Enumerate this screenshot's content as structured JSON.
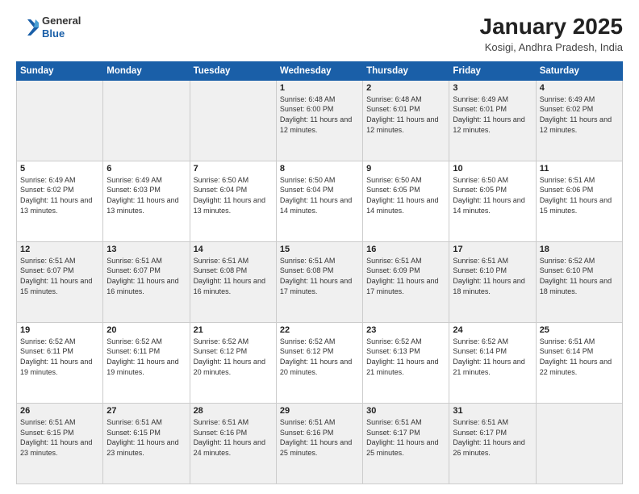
{
  "header": {
    "logo_general": "General",
    "logo_blue": "Blue",
    "month_title": "January 2025",
    "location": "Kosigi, Andhra Pradesh, India"
  },
  "days_of_week": [
    "Sunday",
    "Monday",
    "Tuesday",
    "Wednesday",
    "Thursday",
    "Friday",
    "Saturday"
  ],
  "weeks": [
    [
      {
        "day": "",
        "info": ""
      },
      {
        "day": "",
        "info": ""
      },
      {
        "day": "",
        "info": ""
      },
      {
        "day": "1",
        "info": "Sunrise: 6:48 AM\nSunset: 6:00 PM\nDaylight: 11 hours and 12 minutes."
      },
      {
        "day": "2",
        "info": "Sunrise: 6:48 AM\nSunset: 6:01 PM\nDaylight: 11 hours and 12 minutes."
      },
      {
        "day": "3",
        "info": "Sunrise: 6:49 AM\nSunset: 6:01 PM\nDaylight: 11 hours and 12 minutes."
      },
      {
        "day": "4",
        "info": "Sunrise: 6:49 AM\nSunset: 6:02 PM\nDaylight: 11 hours and 12 minutes."
      }
    ],
    [
      {
        "day": "5",
        "info": "Sunrise: 6:49 AM\nSunset: 6:02 PM\nDaylight: 11 hours and 13 minutes."
      },
      {
        "day": "6",
        "info": "Sunrise: 6:49 AM\nSunset: 6:03 PM\nDaylight: 11 hours and 13 minutes."
      },
      {
        "day": "7",
        "info": "Sunrise: 6:50 AM\nSunset: 6:04 PM\nDaylight: 11 hours and 13 minutes."
      },
      {
        "day": "8",
        "info": "Sunrise: 6:50 AM\nSunset: 6:04 PM\nDaylight: 11 hours and 14 minutes."
      },
      {
        "day": "9",
        "info": "Sunrise: 6:50 AM\nSunset: 6:05 PM\nDaylight: 11 hours and 14 minutes."
      },
      {
        "day": "10",
        "info": "Sunrise: 6:50 AM\nSunset: 6:05 PM\nDaylight: 11 hours and 14 minutes."
      },
      {
        "day": "11",
        "info": "Sunrise: 6:51 AM\nSunset: 6:06 PM\nDaylight: 11 hours and 15 minutes."
      }
    ],
    [
      {
        "day": "12",
        "info": "Sunrise: 6:51 AM\nSunset: 6:07 PM\nDaylight: 11 hours and 15 minutes."
      },
      {
        "day": "13",
        "info": "Sunrise: 6:51 AM\nSunset: 6:07 PM\nDaylight: 11 hours and 16 minutes."
      },
      {
        "day": "14",
        "info": "Sunrise: 6:51 AM\nSunset: 6:08 PM\nDaylight: 11 hours and 16 minutes."
      },
      {
        "day": "15",
        "info": "Sunrise: 6:51 AM\nSunset: 6:08 PM\nDaylight: 11 hours and 17 minutes."
      },
      {
        "day": "16",
        "info": "Sunrise: 6:51 AM\nSunset: 6:09 PM\nDaylight: 11 hours and 17 minutes."
      },
      {
        "day": "17",
        "info": "Sunrise: 6:51 AM\nSunset: 6:10 PM\nDaylight: 11 hours and 18 minutes."
      },
      {
        "day": "18",
        "info": "Sunrise: 6:52 AM\nSunset: 6:10 PM\nDaylight: 11 hours and 18 minutes."
      }
    ],
    [
      {
        "day": "19",
        "info": "Sunrise: 6:52 AM\nSunset: 6:11 PM\nDaylight: 11 hours and 19 minutes."
      },
      {
        "day": "20",
        "info": "Sunrise: 6:52 AM\nSunset: 6:11 PM\nDaylight: 11 hours and 19 minutes."
      },
      {
        "day": "21",
        "info": "Sunrise: 6:52 AM\nSunset: 6:12 PM\nDaylight: 11 hours and 20 minutes."
      },
      {
        "day": "22",
        "info": "Sunrise: 6:52 AM\nSunset: 6:12 PM\nDaylight: 11 hours and 20 minutes."
      },
      {
        "day": "23",
        "info": "Sunrise: 6:52 AM\nSunset: 6:13 PM\nDaylight: 11 hours and 21 minutes."
      },
      {
        "day": "24",
        "info": "Sunrise: 6:52 AM\nSunset: 6:14 PM\nDaylight: 11 hours and 21 minutes."
      },
      {
        "day": "25",
        "info": "Sunrise: 6:51 AM\nSunset: 6:14 PM\nDaylight: 11 hours and 22 minutes."
      }
    ],
    [
      {
        "day": "26",
        "info": "Sunrise: 6:51 AM\nSunset: 6:15 PM\nDaylight: 11 hours and 23 minutes."
      },
      {
        "day": "27",
        "info": "Sunrise: 6:51 AM\nSunset: 6:15 PM\nDaylight: 11 hours and 23 minutes."
      },
      {
        "day": "28",
        "info": "Sunrise: 6:51 AM\nSunset: 6:16 PM\nDaylight: 11 hours and 24 minutes."
      },
      {
        "day": "29",
        "info": "Sunrise: 6:51 AM\nSunset: 6:16 PM\nDaylight: 11 hours and 25 minutes."
      },
      {
        "day": "30",
        "info": "Sunrise: 6:51 AM\nSunset: 6:17 PM\nDaylight: 11 hours and 25 minutes."
      },
      {
        "day": "31",
        "info": "Sunrise: 6:51 AM\nSunset: 6:17 PM\nDaylight: 11 hours and 26 minutes."
      },
      {
        "day": "",
        "info": ""
      }
    ]
  ]
}
